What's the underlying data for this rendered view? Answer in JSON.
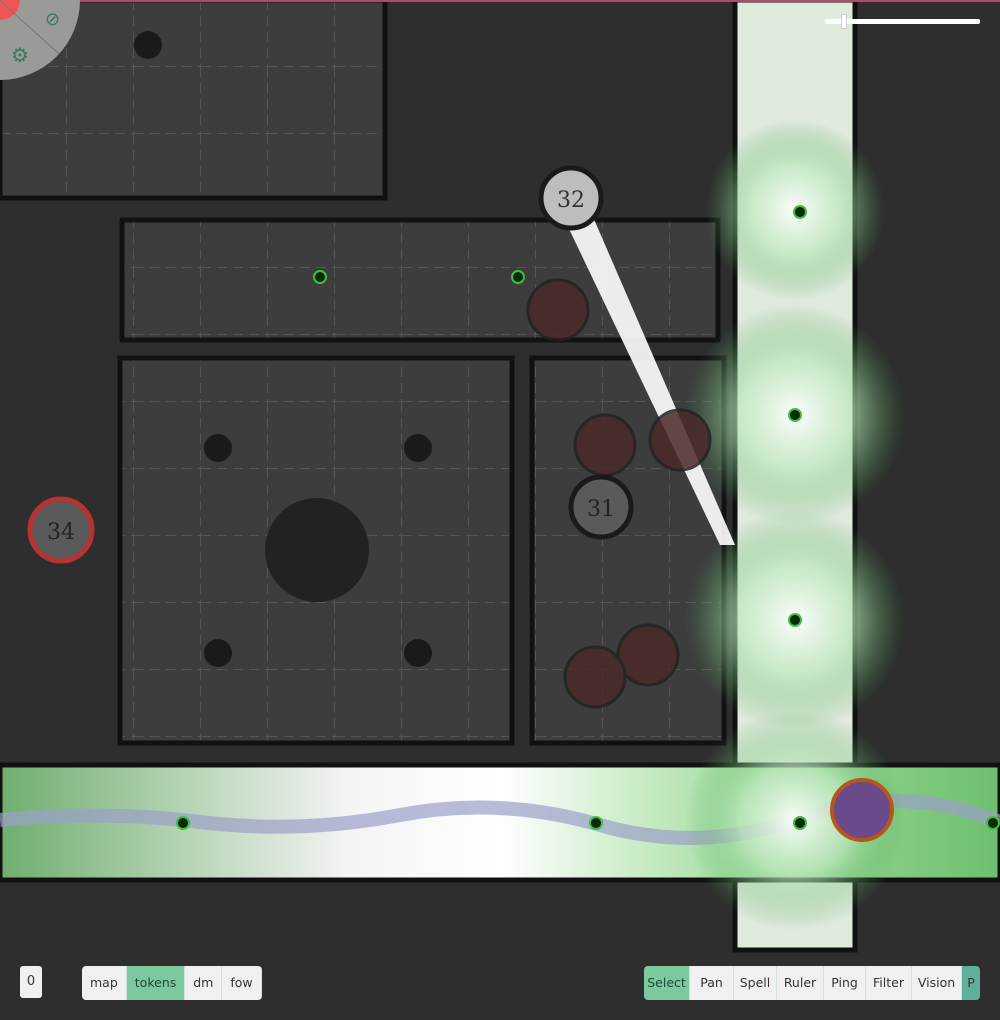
{
  "map": {
    "room_labels": [
      "32",
      "31",
      "34"
    ],
    "accent_color": "#7cc9a0",
    "light_color": "#5bd06a"
  },
  "radial_menu": {
    "icons": [
      "compass-icon",
      "gear-icon"
    ]
  },
  "zoom_slider": {
    "value_percent": 10
  },
  "layer_counter": {
    "value": "0"
  },
  "layers": [
    {
      "label": "map",
      "active": false
    },
    {
      "label": "tokens",
      "active": true
    },
    {
      "label": "dm",
      "active": false
    },
    {
      "label": "fow",
      "active": false
    }
  ],
  "tools": [
    {
      "label": "Select",
      "active": true
    },
    {
      "label": "Pan",
      "active": false
    },
    {
      "label": "Spell",
      "active": false
    },
    {
      "label": "Ruler",
      "active": false
    },
    {
      "label": "Ping",
      "active": false
    },
    {
      "label": "Filter",
      "active": false
    },
    {
      "label": "Vision",
      "active": false
    },
    {
      "label": "P",
      "active": false
    }
  ]
}
